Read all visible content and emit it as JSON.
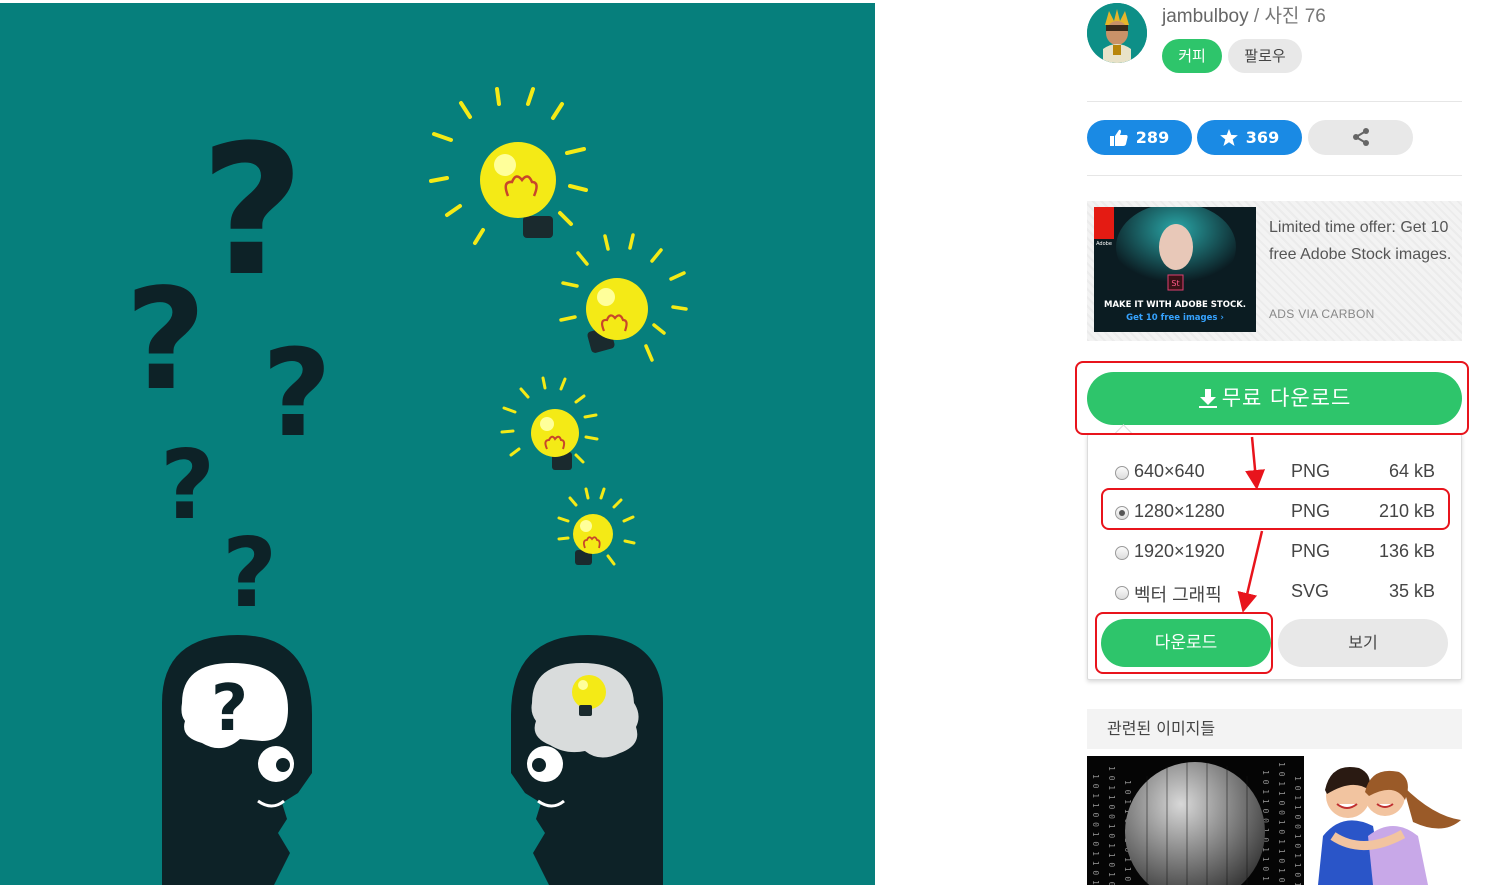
{
  "author": {
    "name": "jambulboy",
    "separator": " / ",
    "photos_label": "사진 76"
  },
  "buttons": {
    "coffee": "커피",
    "follow": "팔로우",
    "free_download": "무료 다운로드",
    "download": "다운로드",
    "view": "보기"
  },
  "stats": {
    "likes": "289",
    "favorites": "369"
  },
  "ad": {
    "text": "Limited time offer: Get 10 free Adobe Stock images.",
    "via": "ADS VIA CARBON",
    "banner_brand": "Adobe",
    "banner_badge": "St",
    "banner_headline": "MAKE IT WITH ADOBE STOCK.",
    "banner_cta": "Get 10 free images ›"
  },
  "download_options": [
    {
      "resolution": "640×640",
      "format": "PNG",
      "size": "64 kB",
      "selected": false
    },
    {
      "resolution": "1280×1280",
      "format": "PNG",
      "size": "210 kB",
      "selected": true
    },
    {
      "resolution": "1920×1920",
      "format": "PNG",
      "size": "136 kB",
      "selected": false
    },
    {
      "resolution": "벡터 그래픽",
      "format": "SVG",
      "size": "35 kB",
      "selected": false
    }
  ],
  "related_title": "관련된 이미지들",
  "thumb_binary_text": "1 0 1 1 0 0 1 0 1 1 0 1 0 0 1",
  "colors": {
    "teal_background": "#067f7c",
    "green": "#2ec56b",
    "blue": "#1a8ae4",
    "annotation_red": "#e8141c",
    "bulb_yellow": "#f4ea16"
  },
  "icons": [
    "question-mark-icon",
    "lightbulb-icon",
    "thumbs-up-icon",
    "star-icon",
    "share-icon",
    "download-arrow-icon"
  ]
}
